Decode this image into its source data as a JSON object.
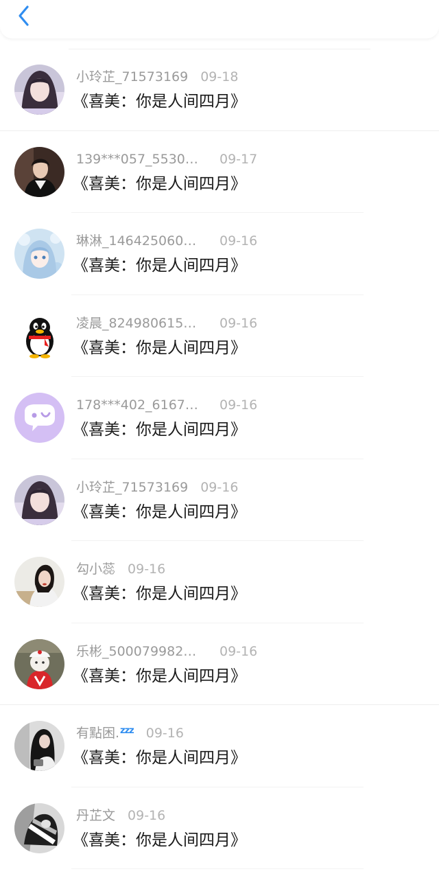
{
  "header": {
    "back_icon": "chevron-left-icon",
    "accent_color": "#2f8df0"
  },
  "comments": [
    {
      "name": "小玲芷_71573169",
      "date": "09-18",
      "title": "《喜美：你是人间四月》",
      "avatar": "anime-girl-dark-hair-avatar"
    },
    {
      "name": "139***057_5530…",
      "date": "09-17",
      "title": "《喜美：你是人间四月》",
      "avatar": "boy-portrait-avatar"
    },
    {
      "name": "琳淋_146425060…",
      "date": "09-16",
      "title": "《喜美：你是人间四月》",
      "avatar": "anime-blue-hair-avatar"
    },
    {
      "name": "凌晨_824980615…",
      "date": "09-16",
      "title": "《喜美：你是人间四月》",
      "avatar": "qq-penguin-avatar"
    },
    {
      "name": "178***402_6167…",
      "date": "09-16",
      "title": "《喜美：你是人间四月》",
      "avatar": "purple-chat-bubble-avatar"
    },
    {
      "name": "小玲芷_71573169",
      "date": "09-16",
      "title": "《喜美：你是人间四月》",
      "avatar": "anime-girl-dark-hair-avatar"
    },
    {
      "name": "勾小蕊",
      "date": "09-16",
      "title": "《喜美：你是人间四月》",
      "avatar": "girl-photo-avatar"
    },
    {
      "name": "乐彬_500079982…",
      "date": "09-16",
      "title": "《喜美：你是人间四月》",
      "avatar": "cat-in-red-shirt-avatar"
    },
    {
      "name": "有點困.",
      "badge": "zzz",
      "date": "09-16",
      "title": "《喜美：你是人间四月》",
      "avatar": "girl-long-hair-avatar"
    },
    {
      "name": "丹芷文",
      "date": "09-16",
      "title": "《喜美：你是人间四月》",
      "avatar": "black-white-photo-avatar"
    }
  ]
}
